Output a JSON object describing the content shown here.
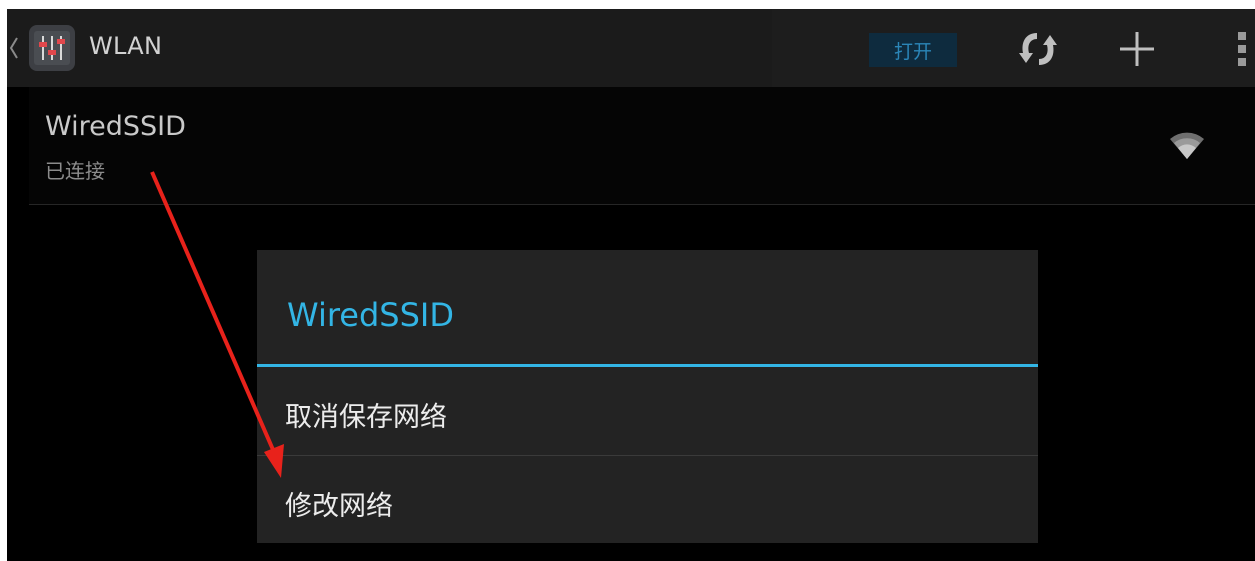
{
  "actionbar": {
    "title": "WLAN",
    "toggle_label": "打开",
    "icons": [
      "back-caret-icon",
      "settings-app-icon",
      "wifi-sync-icon",
      "add-icon",
      "overflow-menu-icon"
    ]
  },
  "network": {
    "name": "WiredSSID",
    "status": "已连接",
    "signal_icon": "wifi-signal-icon"
  },
  "dialog": {
    "title": "WiredSSID",
    "items": [
      {
        "label": "取消保存网络"
      },
      {
        "label": "修改网络"
      }
    ]
  },
  "annotation": {
    "type": "arrow",
    "color": "#e8221b",
    "from": "network-status",
    "to": "menu-item-modify-network"
  },
  "colors": {
    "accent": "#33b5e5",
    "background": "#000000",
    "dialog": "#232323"
  }
}
